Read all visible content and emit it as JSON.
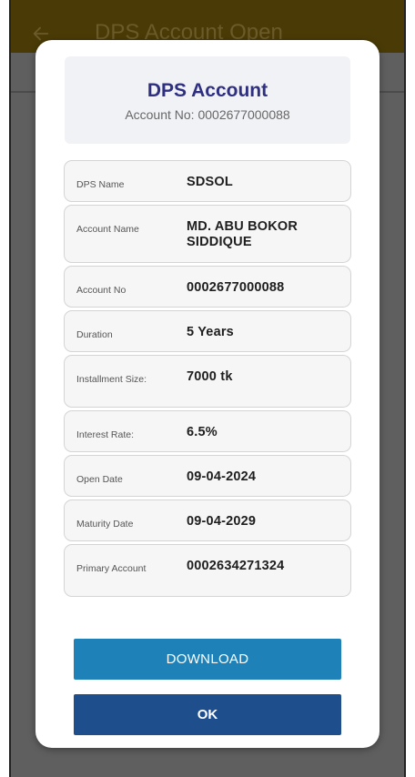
{
  "appbar": {
    "title": "DPS Account Open",
    "back_icon": "arrow-left-icon"
  },
  "header": {
    "title": "DPS Account",
    "account_line": "Account No: 0002677000088"
  },
  "details": [
    {
      "label": "DPS Name",
      "value": "SDSOL"
    },
    {
      "label": "Account Name",
      "value": "MD. ABU BOKOR SIDDIQUE"
    },
    {
      "label": "Account No",
      "value": "0002677000088"
    },
    {
      "label": "Duration",
      "value": "5 Years"
    },
    {
      "label": "Installment Size:",
      "value": "7000 tk"
    },
    {
      "label": "Interest Rate:",
      "value": "6.5%"
    },
    {
      "label": "Open Date",
      "value": "09-04-2024"
    },
    {
      "label": "Maturity Date",
      "value": "09-04-2029"
    },
    {
      "label": "Primary Account",
      "value": "0002634271324"
    }
  ],
  "buttons": {
    "download_label": "DOWNLOAD",
    "ok_label": "OK"
  },
  "colors": {
    "appbar": "#4a3b06",
    "dim_overlay": "#5f5f5f",
    "header_title": "#2f2f82",
    "download": "#1e82b8",
    "ok": "#1e4f8c"
  }
}
